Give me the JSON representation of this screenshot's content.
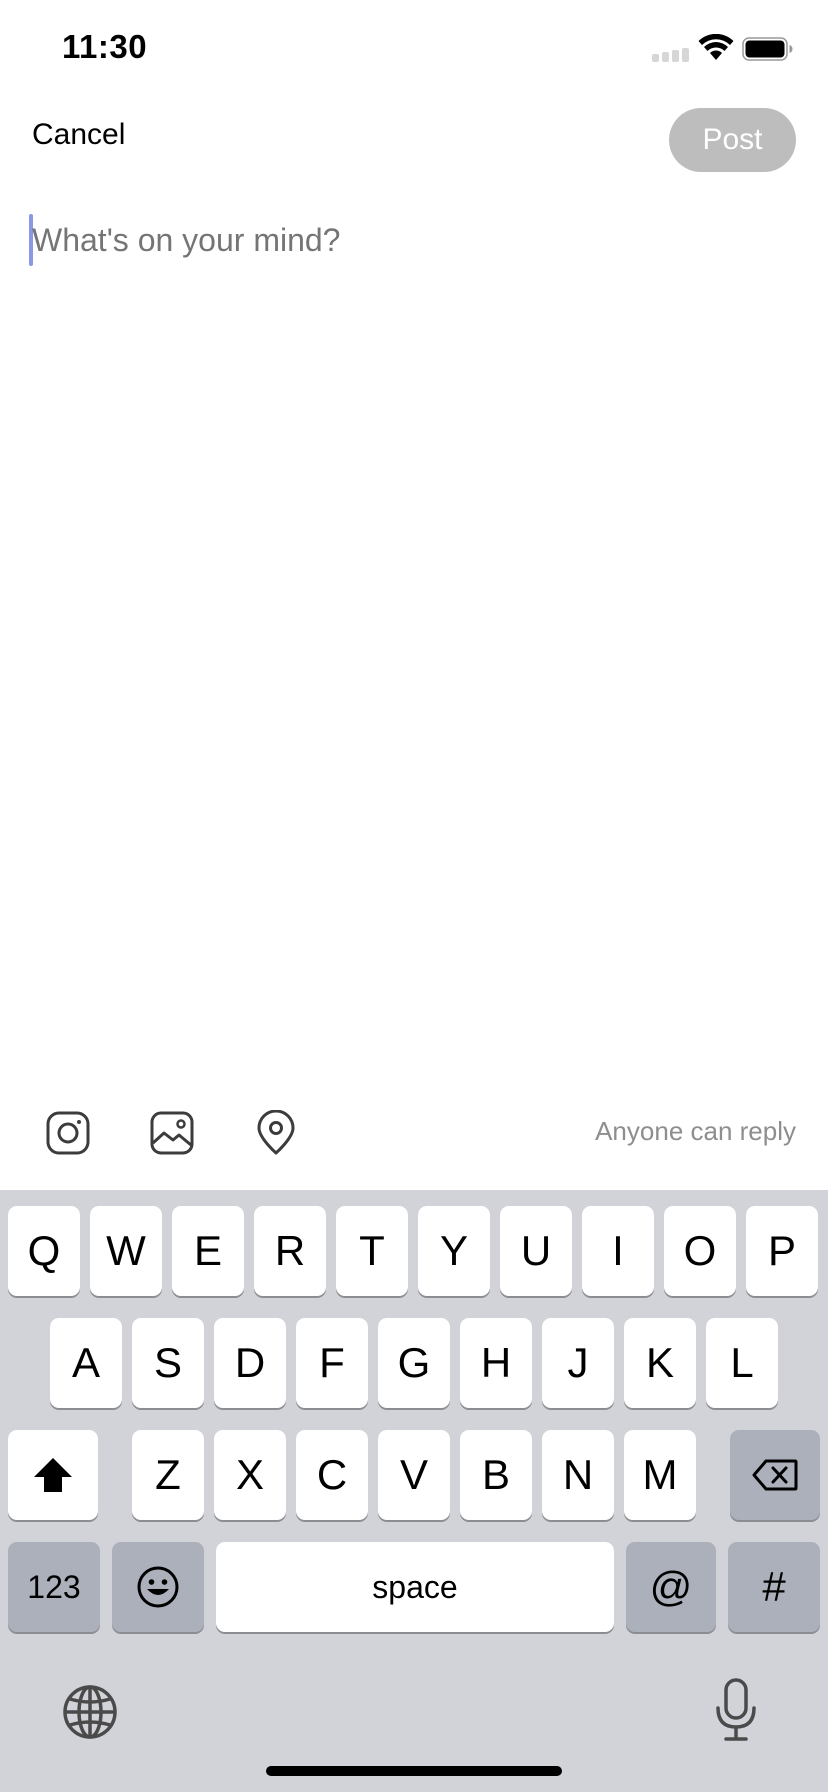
{
  "status_bar": {
    "time": "11:30"
  },
  "header": {
    "cancel_label": "Cancel",
    "post_label": "Post"
  },
  "composer": {
    "placeholder": "What's on your mind?",
    "value": ""
  },
  "toolbar": {
    "icons": [
      "instagram-icon",
      "image-icon",
      "location-pin-icon"
    ],
    "reply_label": "Anyone can reply"
  },
  "keyboard": {
    "row1": [
      "Q",
      "W",
      "E",
      "R",
      "T",
      "Y",
      "U",
      "I",
      "O",
      "P"
    ],
    "row2": [
      "A",
      "S",
      "D",
      "F",
      "G",
      "H",
      "J",
      "K",
      "L"
    ],
    "row3": [
      "Z",
      "X",
      "C",
      "V",
      "B",
      "N",
      "M"
    ],
    "numbers_label": "123",
    "space_label": "space",
    "at_label": "@",
    "hash_label": "#"
  },
  "colors": {
    "post_button_disabled": "#bdbdbd",
    "keyboard_background": "#d1d3d9",
    "cursor": "#8a96e6",
    "placeholder": "#9b9b9b"
  }
}
